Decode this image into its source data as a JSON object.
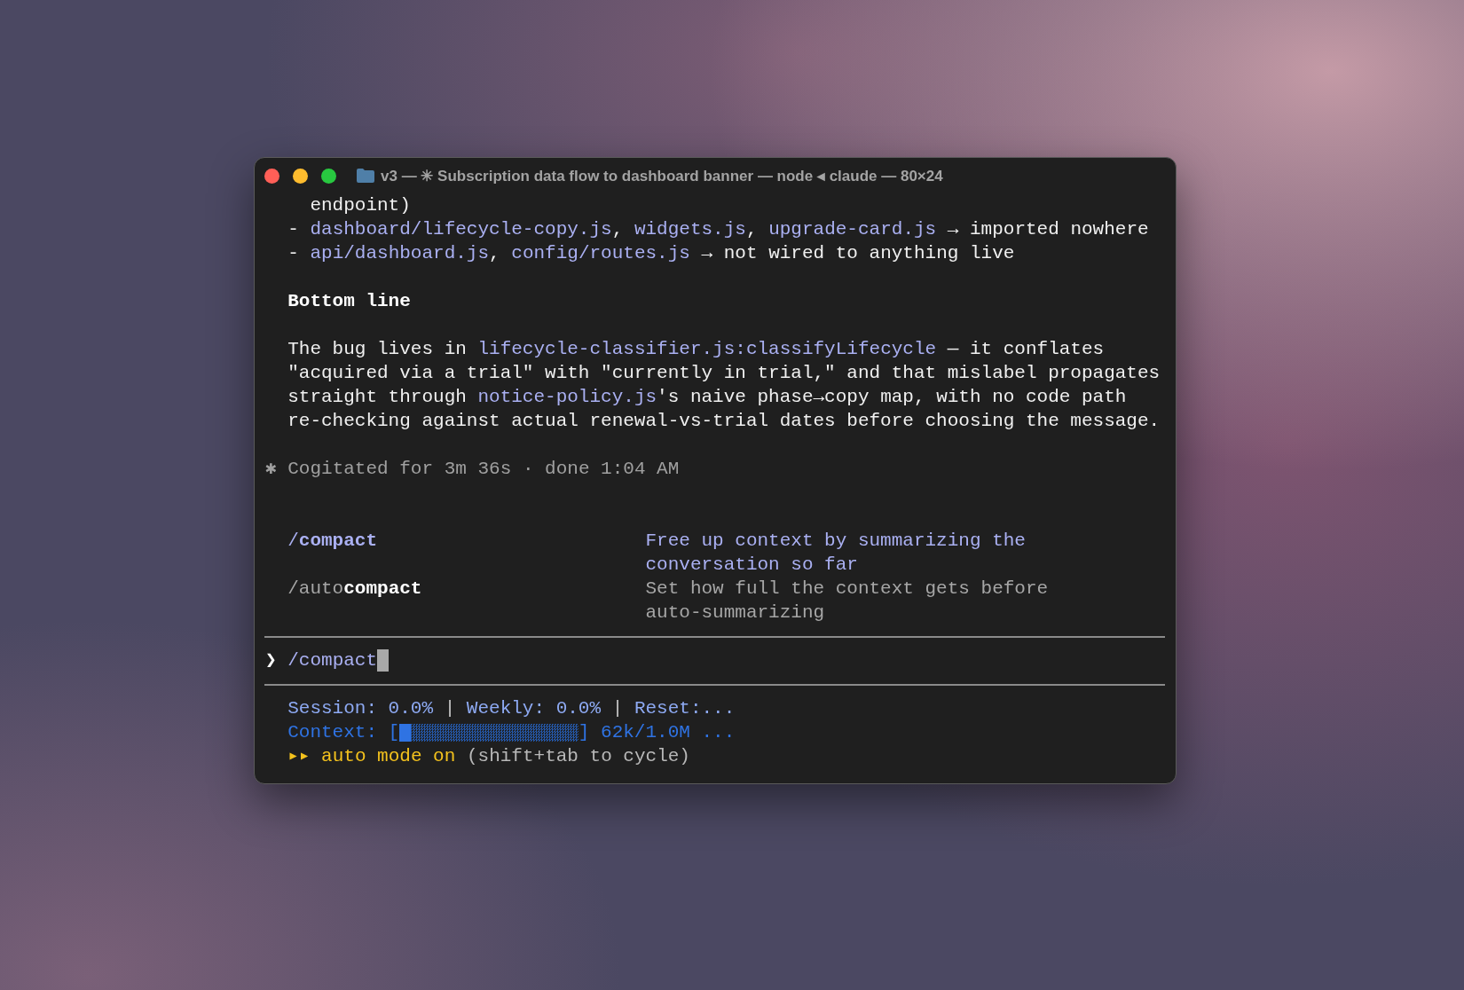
{
  "window": {
    "title": "v3 — ✳ Subscription data flow to dashboard banner — node ◂ claude — 80×24"
  },
  "transcript": [
    {
      "kind": "continuation",
      "segments": [
        {
          "kind": "text",
          "text": "endpoint)"
        }
      ]
    },
    {
      "kind": "bullet",
      "segments": [
        {
          "kind": "text",
          "text": "- "
        },
        {
          "kind": "file",
          "text": "dashboard/lifecycle-copy.js"
        },
        {
          "kind": "text",
          "text": ", "
        },
        {
          "kind": "file",
          "text": "widgets.js"
        },
        {
          "kind": "text",
          "text": ", "
        },
        {
          "kind": "file",
          "text": "upgrade-card.js"
        },
        {
          "kind": "text",
          "text": " → imported nowhere"
        }
      ]
    },
    {
      "kind": "bullet",
      "segments": [
        {
          "kind": "text",
          "text": "- "
        },
        {
          "kind": "file",
          "text": "api/dashboard.js"
        },
        {
          "kind": "text",
          "text": ", "
        },
        {
          "kind": "file",
          "text": "config/routes.js"
        },
        {
          "kind": "text",
          "text": " → not wired to anything live"
        }
      ]
    },
    {
      "kind": "blank"
    },
    {
      "kind": "paragraph",
      "segments": [
        {
          "kind": "bold",
          "text": "Bottom line"
        }
      ]
    },
    {
      "kind": "blank"
    },
    {
      "kind": "paragraph",
      "segments": [
        {
          "kind": "text",
          "text": "The bug lives in "
        },
        {
          "kind": "file",
          "text": "lifecycle-classifier.js:classifyLifecycle"
        },
        {
          "kind": "text",
          "text": " — it conflates"
        }
      ]
    },
    {
      "kind": "paragraph",
      "segments": [
        {
          "kind": "text",
          "text": "\"acquired via a trial\" with \"currently in trial,\" and that mislabel propagates"
        }
      ]
    },
    {
      "kind": "paragraph",
      "segments": [
        {
          "kind": "text",
          "text": "straight through "
        },
        {
          "kind": "file",
          "text": "notice-policy.js"
        },
        {
          "kind": "text",
          "text": "'s naive phase→copy map, with no code path"
        }
      ]
    },
    {
      "kind": "paragraph",
      "segments": [
        {
          "kind": "text",
          "text": "re-checking against actual renewal-vs-trial dates before choosing the message."
        }
      ]
    },
    {
      "kind": "blank"
    },
    {
      "kind": "note",
      "segments": [
        {
          "kind": "dim",
          "text": "✱ Cogitated for 3m 36s · done 1:04 AM"
        }
      ]
    },
    {
      "kind": "blank"
    },
    {
      "kind": "blank"
    }
  ],
  "menu": [
    {
      "prefix": "/",
      "match": "compact",
      "description": [
        "Free up context by summarizing the",
        "conversation so far"
      ],
      "selected": true
    },
    {
      "prefix": "/auto",
      "match": "compact",
      "description": [
        "Set how full the context gets before",
        "auto-summarizing"
      ],
      "selected": false
    }
  ],
  "prompt": {
    "symbol": "❯",
    "value": "/compact"
  },
  "status": [
    {
      "segments": [
        {
          "kind": "usage",
          "text": "Session: 0.0%"
        },
        {
          "kind": "pipe",
          "text": " | "
        },
        {
          "kind": "usage",
          "text": "Weekly: 0.0%"
        },
        {
          "kind": "pipe",
          "text": " | "
        },
        {
          "kind": "usage",
          "text": "Reset:..."
        }
      ]
    },
    {
      "segments": [
        {
          "kind": "context",
          "text": "Context: ["
        },
        {
          "kind": "meter",
          "level": 0.062
        },
        {
          "kind": "context",
          "text": "] 62k/1.0M ..."
        }
      ]
    },
    {
      "segments": [
        {
          "kind": "mode",
          "text": "▸▸ auto mode on"
        },
        {
          "kind": "hint",
          "text": " (shift+tab to cycle)"
        }
      ]
    }
  ]
}
